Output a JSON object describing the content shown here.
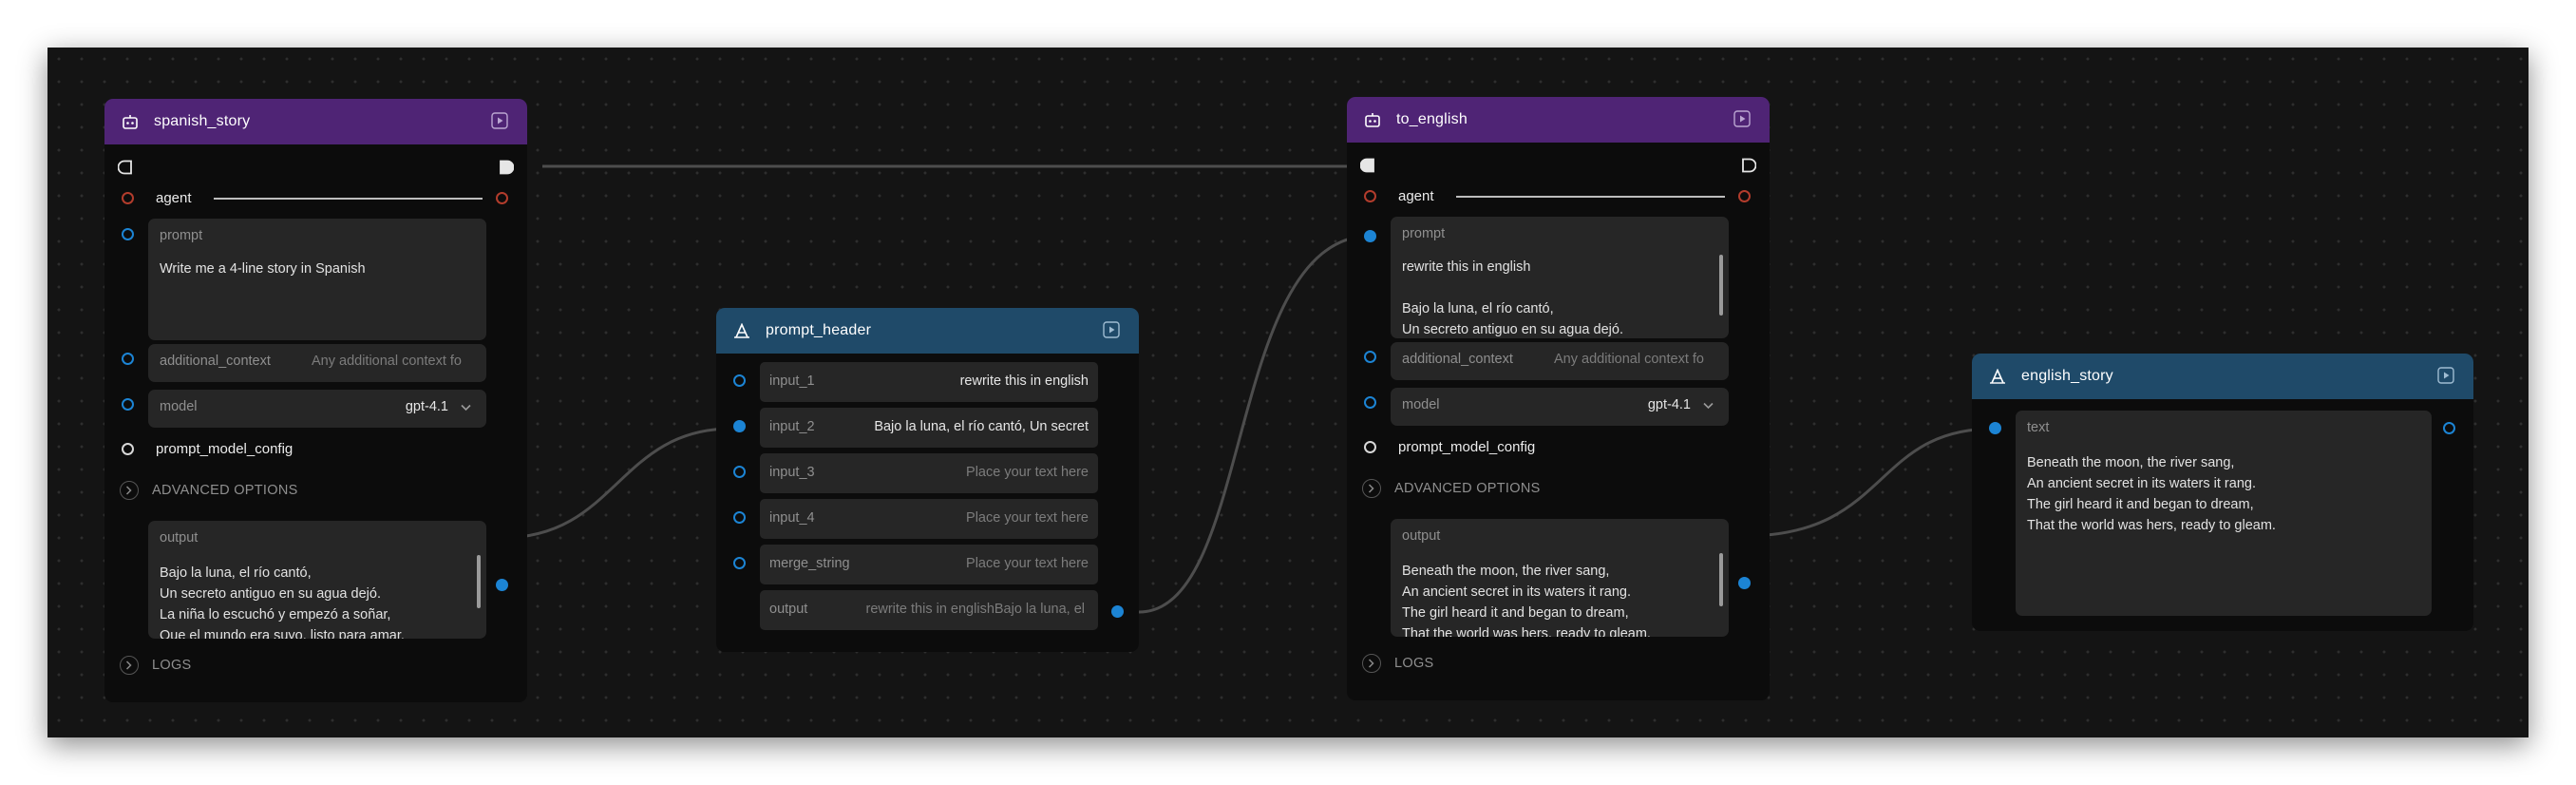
{
  "nodes": {
    "spanish_story": {
      "title": "spanish_story",
      "agent_label": "agent",
      "prompt": {
        "label": "prompt",
        "value": "Write me a 4-line story in Spanish"
      },
      "additional_context": {
        "label": "additional_context",
        "placeholder": "Any additional context fo"
      },
      "model": {
        "label": "model",
        "value": "gpt-4.1"
      },
      "prompt_model_config_label": "prompt_model_config",
      "advanced_options_label": "ADVANCED OPTIONS",
      "output": {
        "label": "output",
        "value": "Bajo la luna, el río cantó,\nUn secreto antiguo en su agua dejó.\nLa niña lo escuchó y empezó a soñar,\nQue el mundo era suyo, listo para amar."
      },
      "logs_label": "LOGS"
    },
    "prompt_header": {
      "title": "prompt_header",
      "input_1": {
        "label": "input_1",
        "value": "rewrite this in english"
      },
      "input_2": {
        "label": "input_2",
        "value": "Bajo la luna, el río cantó,  Un secret"
      },
      "input_3": {
        "label": "input_3",
        "placeholder": "Place your text here"
      },
      "input_4": {
        "label": "input_4",
        "placeholder": "Place your text here"
      },
      "merge_string": {
        "label": "merge_string",
        "placeholder": "Place your text here"
      },
      "output": {
        "label": "output",
        "value": "rewrite this in englishBajo la luna, el"
      }
    },
    "to_english": {
      "title": "to_english",
      "agent_label": "agent",
      "prompt": {
        "label": "prompt",
        "value": "rewrite this in english\n\nBajo la luna, el río cantó,\nUn secreto antiguo en su agua dejó."
      },
      "additional_context": {
        "label": "additional_context",
        "placeholder": "Any additional context fo"
      },
      "model": {
        "label": "model",
        "value": "gpt-4.1"
      },
      "prompt_model_config_label": "prompt_model_config",
      "advanced_options_label": "ADVANCED OPTIONS",
      "output": {
        "label": "output",
        "value": "Beneath the moon, the river sang,\nAn ancient secret in its waters it rang.\nThe girl heard it and began to dream,\nThat the world was hers, ready to gleam."
      },
      "logs_label": "LOGS"
    },
    "english_story": {
      "title": "english_story",
      "text": {
        "label": "text",
        "value": "Beneath the moon, the river sang,\nAn ancient secret in its waters it rang.\nThe girl heard it and began to dream,\nThat the world was hers, ready to gleam."
      }
    }
  },
  "colors": {
    "canvas": "#141414",
    "agent_header": "#4f2475",
    "text_header": "#1f4a69",
    "port_blue": "#1c84d4",
    "port_red": "#b23c2c",
    "wire": "#4d4d4d"
  },
  "icons": [
    "robot-icon",
    "text-a-icon",
    "play-icon",
    "flow-in-icon",
    "flow-out-icon",
    "chevron-right-icon",
    "chevron-down-icon"
  ]
}
